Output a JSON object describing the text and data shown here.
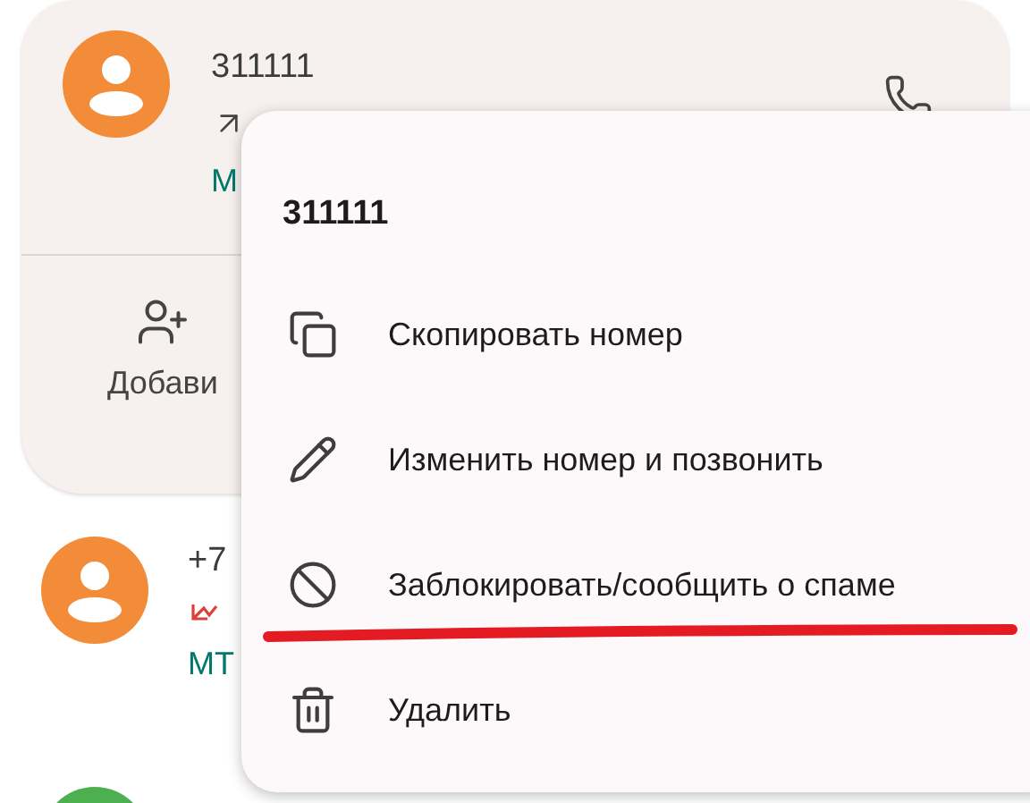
{
  "call_log": [
    {
      "color": "#f28c38",
      "number": "311111",
      "kind": "outgoing",
      "carrier": "М",
      "expanded": true,
      "actions": [
        {
          "label": "Добави"
        }
      ]
    },
    {
      "color": "#f28c38",
      "number": "+7",
      "kind": "missed",
      "carrier": "МТ",
      "expanded": false
    },
    {
      "color": "#4caf50",
      "expanded": false
    }
  ],
  "menu": {
    "title": "311111",
    "items": [
      {
        "kind": "copy",
        "label": "Скопировать номер"
      },
      {
        "kind": "edit",
        "label": "Изменить номер и позвонить"
      },
      {
        "kind": "block",
        "label": "Заблокировать/сообщить о спаме"
      },
      {
        "kind": "delete",
        "label": "Удалить"
      }
    ]
  }
}
